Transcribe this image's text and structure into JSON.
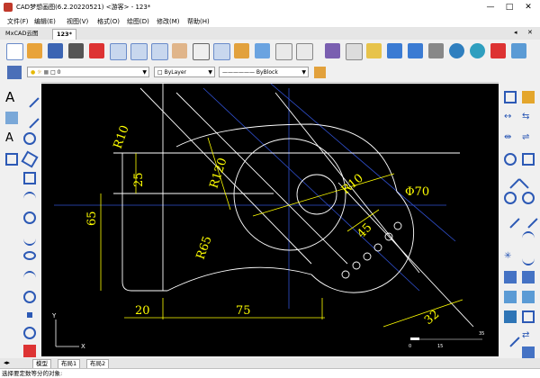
{
  "window": {
    "title": "CAD梦想画图(6.2.20220521) <游客> - 123*",
    "min": "—",
    "max": "□",
    "close": "✕"
  },
  "menu": [
    "文件(F)",
    "编辑(E)",
    "视图(V)",
    "格式(O)",
    "绘图(D)",
    "修改(M)",
    "帮助(H)"
  ],
  "doc_tabs": [
    {
      "label": "MxCAD云图",
      "active": false
    },
    {
      "label": "123*",
      "active": true
    }
  ],
  "tabstrip_controls": {
    "arrow": "◂",
    "close": "✕"
  },
  "properties": {
    "layer": "0",
    "linetype": "ByLayer",
    "lineweight": "ByBlock"
  },
  "dimensions": {
    "r10_left": "R10",
    "d25": "25",
    "r120": "R120",
    "r10_center": "R10",
    "phi70": "Φ70",
    "d65": "65",
    "d45": "45",
    "r65": "R65",
    "d20": "20",
    "d75": "75",
    "d32": "32"
  },
  "scalebar": {
    "t0": "0",
    "t15": "15",
    "t30": "35"
  },
  "ucs": {
    "y": "Y",
    "x": "X"
  },
  "layout_tabs": [
    "模型",
    "布局1",
    "布局2"
  ],
  "command_prompt": "选择要定数等分的对象:",
  "colors": {
    "canvas": "#000000",
    "dim": "#ffff00",
    "geom": "#ffffff",
    "center": "#4060ff"
  }
}
